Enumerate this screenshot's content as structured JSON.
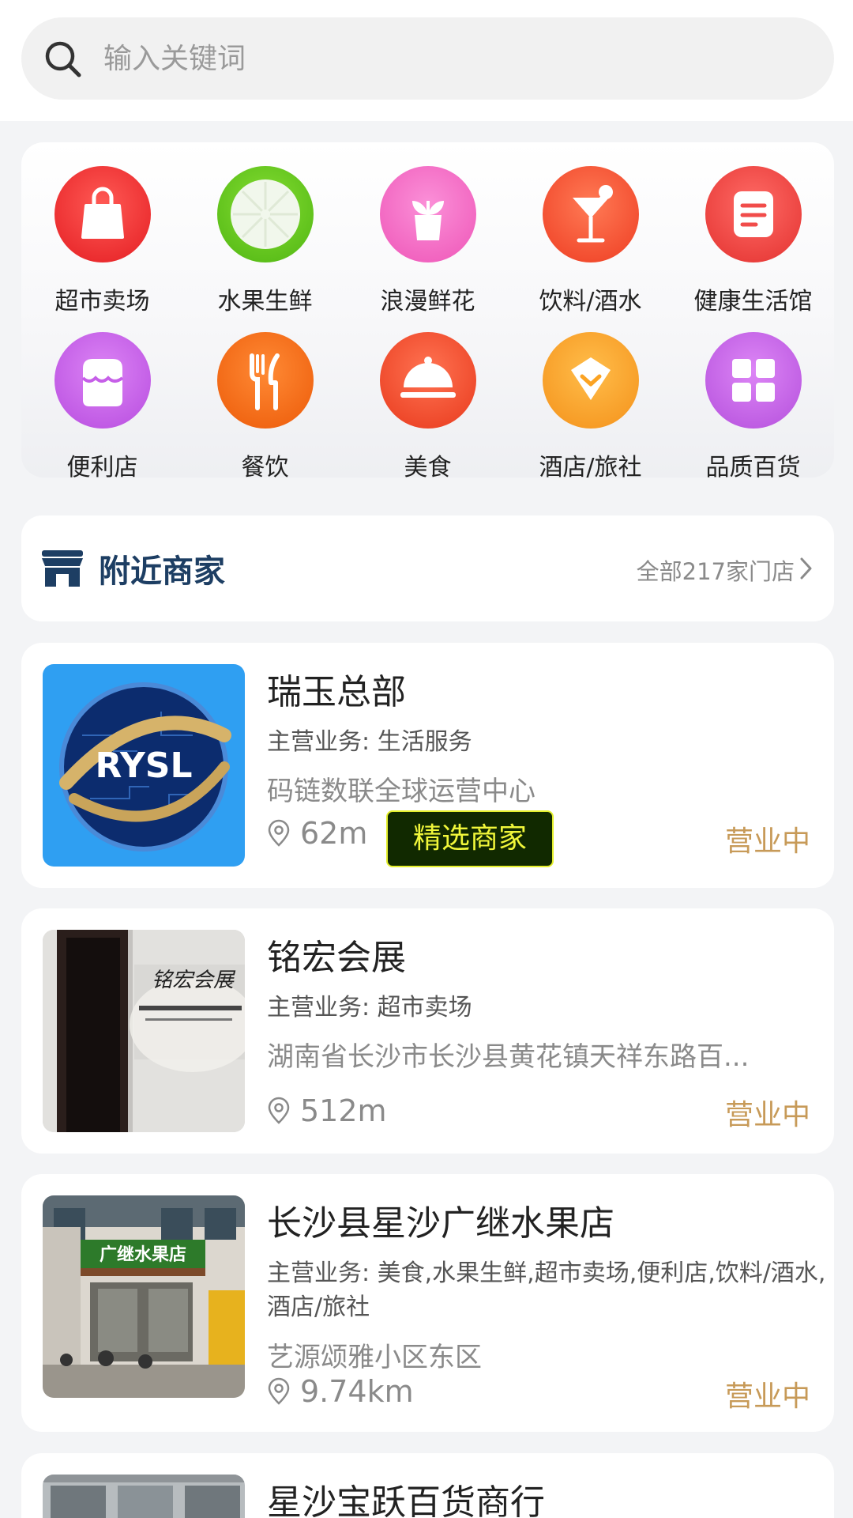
{
  "search": {
    "placeholder": "输入关键词",
    "icon": "search-icon"
  },
  "categories": [
    {
      "label": "超市卖场",
      "icon": "shopping-bag-icon",
      "color": "#ee3334"
    },
    {
      "label": "水果生鲜",
      "icon": "lime-icon",
      "color": "#60c21c"
    },
    {
      "label": "浪漫鲜花",
      "icon": "flower-pot-icon",
      "color": "#f46ec4"
    },
    {
      "label": "饮料/酒水",
      "icon": "cocktail-icon",
      "color": "#f55233"
    },
    {
      "label": "健康生活馆",
      "icon": "document-icon",
      "color": "#f14c4a"
    },
    {
      "label": "便利店",
      "icon": "storefront-icon",
      "color": "#c65fe8"
    },
    {
      "label": "餐饮",
      "icon": "fork-knife-icon",
      "color": "#f76c14"
    },
    {
      "label": "美食",
      "icon": "cloche-icon",
      "color": "#f44f33"
    },
    {
      "label": "酒店/旅社",
      "icon": "diamond-icon",
      "color": "#fba323"
    },
    {
      "label": "品质百货",
      "icon": "grid-icon",
      "color": "#c461e6"
    }
  ],
  "nearby": {
    "title": "附近商家",
    "all_label": "全部217家门店"
  },
  "merchants": [
    {
      "name": "瑞玉总部",
      "business": "主营业务: 生活服务",
      "address": "码链数联全球运营中心",
      "distance": "62m",
      "badge": "精选商家",
      "status": "营业中",
      "logo_text": "RYSL"
    },
    {
      "name": "铭宏会展",
      "business": "主营业务: 超市卖场",
      "address": "湖南省长沙市长沙县黄花镇天祥东路百...",
      "distance": "512m",
      "status": "营业中",
      "sign_text": "铭宏会展"
    },
    {
      "name": "长沙县星沙广继水果店",
      "business": "主营业务: 美食,水果生鲜,超市卖场,便利店,饮料/酒水,酒店/旅社",
      "address": "艺源颂雅小区东区",
      "distance": "9.74km",
      "status": "营业中",
      "sign_text": "广继水果店"
    },
    {
      "name": "星沙宝跃百货商行"
    }
  ],
  "colors": {
    "accent": "#1d3e63",
    "status": "#c79a58",
    "badge_bg": "#112900",
    "badge_text": "#f1f73a"
  }
}
